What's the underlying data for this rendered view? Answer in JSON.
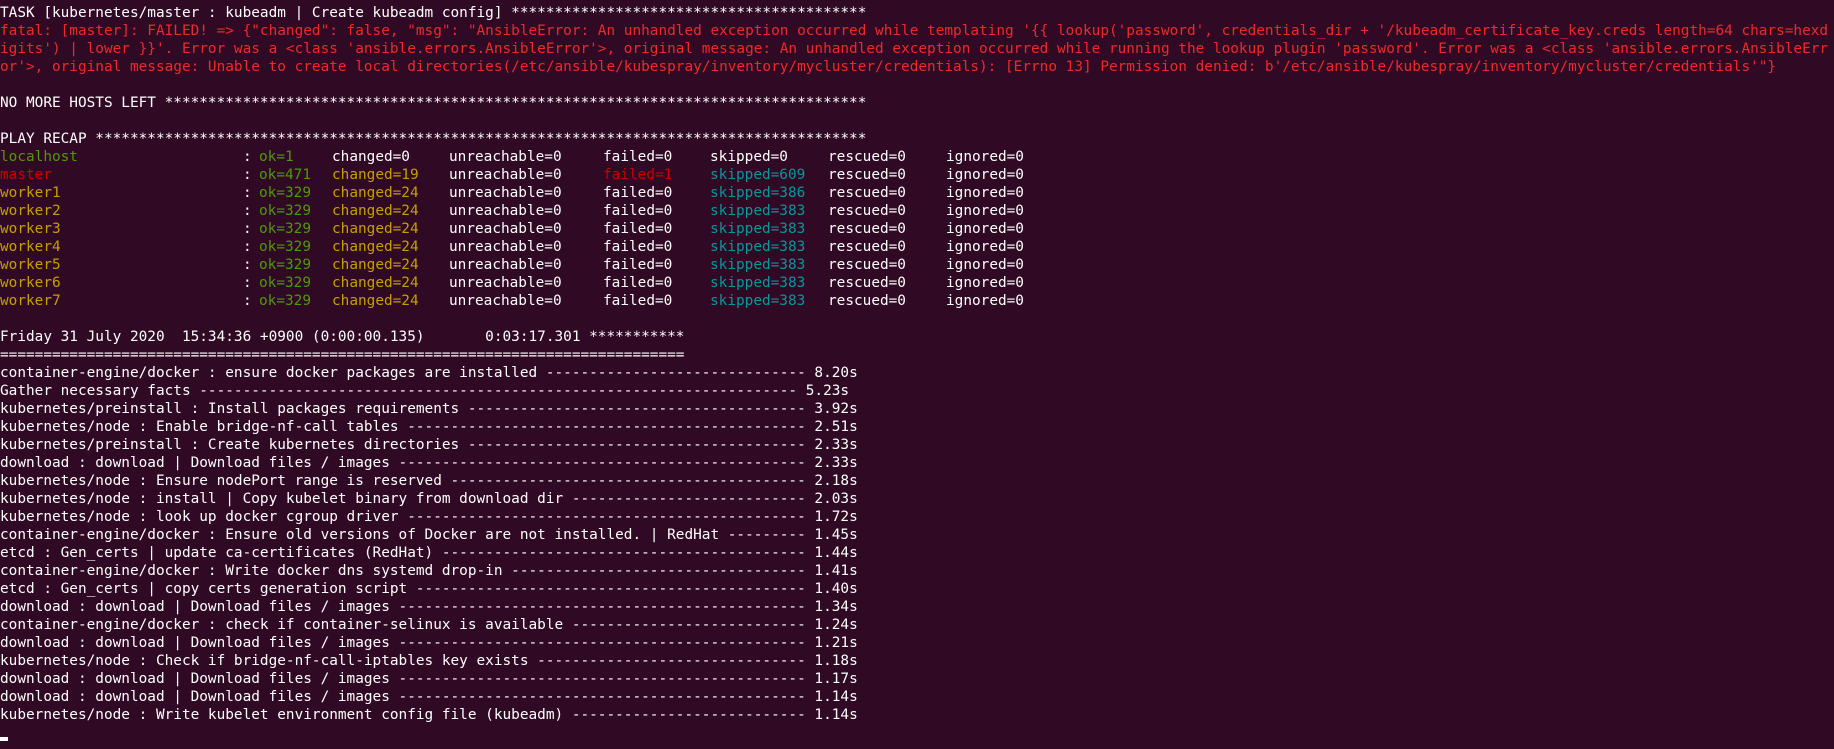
{
  "task_header": "TASK [kubernetes/master : kubeadm | Create kubeadm config] *****************************************",
  "fatal_message": "fatal: [master]: FAILED! => {\"changed\": false, \"msg\": \"AnsibleError: An unhandled exception occurred while templating '{{ lookup('password', credentials_dir + '/kubeadm_certificate_key.creds length=64 chars=hexdigits') | lower }}'. Error was a <class 'ansible.errors.AnsibleError'>, original message: An unhandled exception occurred while running the lookup plugin 'password'. Error was a <class 'ansible.errors.AnsibleError'>, original message: Unable to create local directories(/etc/ansible/kubespray/inventory/mycluster/credentials): [Errno 13] Permission denied: b'/etc/ansible/kubespray/inventory/mycluster/credentials'\"}",
  "no_more_hosts": "NO MORE HOSTS LEFT *********************************************************************************",
  "play_recap_header": "PLAY RECAP *****************************************************************************************",
  "recap": [
    {
      "host": "localhost",
      "ok": "ok=1",
      "changed": "changed=0",
      "unreachable": "unreachable=0",
      "failed": "failed=0",
      "skipped": "skipped=0",
      "rescued": "rescued=0",
      "ignored": "ignored=0",
      "host_color": "#4e9a06",
      "ok_color": "#4e9a06",
      "changed_color": "#ffffff",
      "failed_color": "#ffffff",
      "skipped_color": "#ffffff"
    },
    {
      "host": "master",
      "ok": "ok=471",
      "changed": "changed=19",
      "unreachable": "unreachable=0",
      "failed": "failed=1",
      "skipped": "skipped=609",
      "rescued": "rescued=0",
      "ignored": "ignored=0",
      "host_color": "#cc0000",
      "ok_color": "#4e9a06",
      "changed_color": "#c4a000",
      "failed_color": "#cc0000",
      "skipped_color": "#06989a"
    },
    {
      "host": "worker1",
      "ok": "ok=329",
      "changed": "changed=24",
      "unreachable": "unreachable=0",
      "failed": "failed=0",
      "skipped": "skipped=386",
      "rescued": "rescued=0",
      "ignored": "ignored=0",
      "host_color": "#c4a000",
      "ok_color": "#4e9a06",
      "changed_color": "#c4a000",
      "failed_color": "#ffffff",
      "skipped_color": "#06989a"
    },
    {
      "host": "worker2",
      "ok": "ok=329",
      "changed": "changed=24",
      "unreachable": "unreachable=0",
      "failed": "failed=0",
      "skipped": "skipped=383",
      "rescued": "rescued=0",
      "ignored": "ignored=0",
      "host_color": "#c4a000",
      "ok_color": "#4e9a06",
      "changed_color": "#c4a000",
      "failed_color": "#ffffff",
      "skipped_color": "#06989a"
    },
    {
      "host": "worker3",
      "ok": "ok=329",
      "changed": "changed=24",
      "unreachable": "unreachable=0",
      "failed": "failed=0",
      "skipped": "skipped=383",
      "rescued": "rescued=0",
      "ignored": "ignored=0",
      "host_color": "#c4a000",
      "ok_color": "#4e9a06",
      "changed_color": "#c4a000",
      "failed_color": "#ffffff",
      "skipped_color": "#06989a"
    },
    {
      "host": "worker4",
      "ok": "ok=329",
      "changed": "changed=24",
      "unreachable": "unreachable=0",
      "failed": "failed=0",
      "skipped": "skipped=383",
      "rescued": "rescued=0",
      "ignored": "ignored=0",
      "host_color": "#c4a000",
      "ok_color": "#4e9a06",
      "changed_color": "#c4a000",
      "failed_color": "#ffffff",
      "skipped_color": "#06989a"
    },
    {
      "host": "worker5",
      "ok": "ok=329",
      "changed": "changed=24",
      "unreachable": "unreachable=0",
      "failed": "failed=0",
      "skipped": "skipped=383",
      "rescued": "rescued=0",
      "ignored": "ignored=0",
      "host_color": "#c4a000",
      "ok_color": "#4e9a06",
      "changed_color": "#c4a000",
      "failed_color": "#ffffff",
      "skipped_color": "#06989a"
    },
    {
      "host": "worker6",
      "ok": "ok=329",
      "changed": "changed=24",
      "unreachable": "unreachable=0",
      "failed": "failed=0",
      "skipped": "skipped=383",
      "rescued": "rescued=0",
      "ignored": "ignored=0",
      "host_color": "#c4a000",
      "ok_color": "#4e9a06",
      "changed_color": "#c4a000",
      "failed_color": "#ffffff",
      "skipped_color": "#06989a"
    },
    {
      "host": "worker7",
      "ok": "ok=329",
      "changed": "changed=24",
      "unreachable": "unreachable=0",
      "failed": "failed=0",
      "skipped": "skipped=383",
      "rescued": "rescued=0",
      "ignored": "ignored=0",
      "host_color": "#c4a000",
      "ok_color": "#4e9a06",
      "changed_color": "#c4a000",
      "failed_color": "#ffffff",
      "skipped_color": "#06989a"
    }
  ],
  "timestamp_line": "Friday 31 July 2020  15:34:36 +0900 (0:00:00.135)       0:03:17.301 ***********",
  "separator": "===============================================================================",
  "timings": [
    {
      "task": "container-engine/docker : ensure docker packages are installed ------------------------------",
      "time": "8.20s"
    },
    {
      "task": "Gather necessary facts ---------------------------------------------------------------------",
      "time": "5.23s"
    },
    {
      "task": "kubernetes/preinstall : Install packages requirements ---------------------------------------",
      "time": "3.92s"
    },
    {
      "task": "kubernetes/node : Enable bridge-nf-call tables ----------------------------------------------",
      "time": "2.51s"
    },
    {
      "task": "kubernetes/preinstall : Create kubernetes directories ---------------------------------------",
      "time": "2.33s"
    },
    {
      "task": "download : download | Download files / images -----------------------------------------------",
      "time": "2.33s"
    },
    {
      "task": "kubernetes/node : Ensure nodePort range is reserved -----------------------------------------",
      "time": "2.18s"
    },
    {
      "task": "kubernetes/node : install | Copy kubelet binary from download dir ---------------------------",
      "time": "2.03s"
    },
    {
      "task": "kubernetes/node : look up docker cgroup driver ----------------------------------------------",
      "time": "1.72s"
    },
    {
      "task": "container-engine/docker : Ensure old versions of Docker are not installed. | RedHat ---------",
      "time": "1.45s"
    },
    {
      "task": "etcd : Gen_certs | update ca-certificates (RedHat) ------------------------------------------",
      "time": "1.44s"
    },
    {
      "task": "container-engine/docker : Write docker dns systemd drop-in ----------------------------------",
      "time": "1.41s"
    },
    {
      "task": "etcd : Gen_certs | copy certs generation script ---------------------------------------------",
      "time": "1.40s"
    },
    {
      "task": "download : download | Download files / images -----------------------------------------------",
      "time": "1.34s"
    },
    {
      "task": "container-engine/docker : check if container-selinux is available ---------------------------",
      "time": "1.24s"
    },
    {
      "task": "download : download | Download files / images -----------------------------------------------",
      "time": "1.21s"
    },
    {
      "task": "kubernetes/node : Check if bridge-nf-call-iptables key exists -------------------------------",
      "time": "1.18s"
    },
    {
      "task": "download : download | Download files / images -----------------------------------------------",
      "time": "1.17s"
    },
    {
      "task": "download : download | Download files / images -----------------------------------------------",
      "time": "1.14s"
    },
    {
      "task": "kubernetes/node : Write kubelet environment config file (kubeadm) ---------------------------",
      "time": "1.14s"
    }
  ],
  "colors": {
    "background": "#300a24",
    "foreground": "#ffffff",
    "error": "#ef2929",
    "ok": "#4e9a06",
    "changed": "#c4a000",
    "skipped": "#06989a"
  }
}
